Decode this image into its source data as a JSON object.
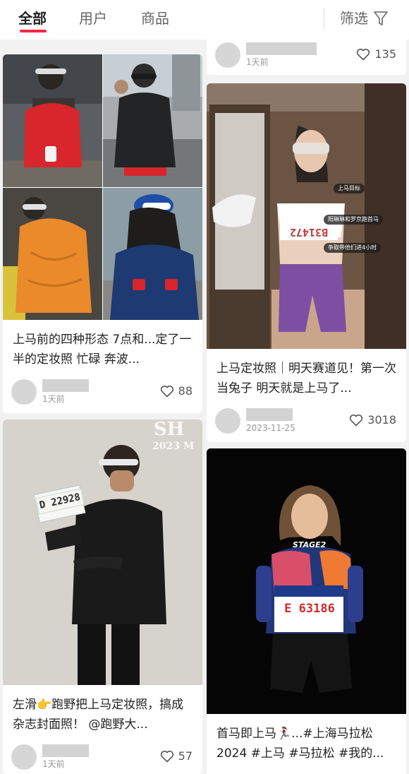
{
  "header": {
    "tabs": [
      {
        "label": "全部"
      },
      {
        "label": "用户"
      },
      {
        "label": "商品"
      }
    ],
    "filter_label": "筛选"
  },
  "feed": {
    "left": [
      {
        "title": "上马前的四种形态 7点和...定了一半的定妆照 忙碌 奔波...",
        "time": "1天前",
        "likes": "88"
      },
      {
        "title": "左滑👉跑野把上马定妆照，搞成杂志封面照！ @跑野大...",
        "time": "1天前",
        "likes": "57",
        "bib": "D 22928",
        "watermark_line1": "SH",
        "watermark_line2": "2023 M"
      }
    ],
    "right": [
      {
        "time": "1天前",
        "likes": "135"
      },
      {
        "title": "上马定妆照｜明天赛道见！第一次当兔子 明天就是上马了...",
        "time": "2023-11-25",
        "likes": "3018",
        "bib": "B31472",
        "overlay_tags": [
          "上马目标",
          "阳琳琳和罗京跑首马",
          "争取带他们进4小时"
        ]
      },
      {
        "title": "首马即上马🏃‍♀️...#上海马拉松2024 #上马 #马拉松 #我的...",
        "shirt_text": "STAGE2",
        "bib": "E 63186"
      }
    ]
  },
  "colors": {
    "accent": "#ff2442",
    "background": "#f2f2f2",
    "card": "#ffffff"
  },
  "icons": {
    "filter": "funnel-icon",
    "like": "heart-outline-icon"
  }
}
